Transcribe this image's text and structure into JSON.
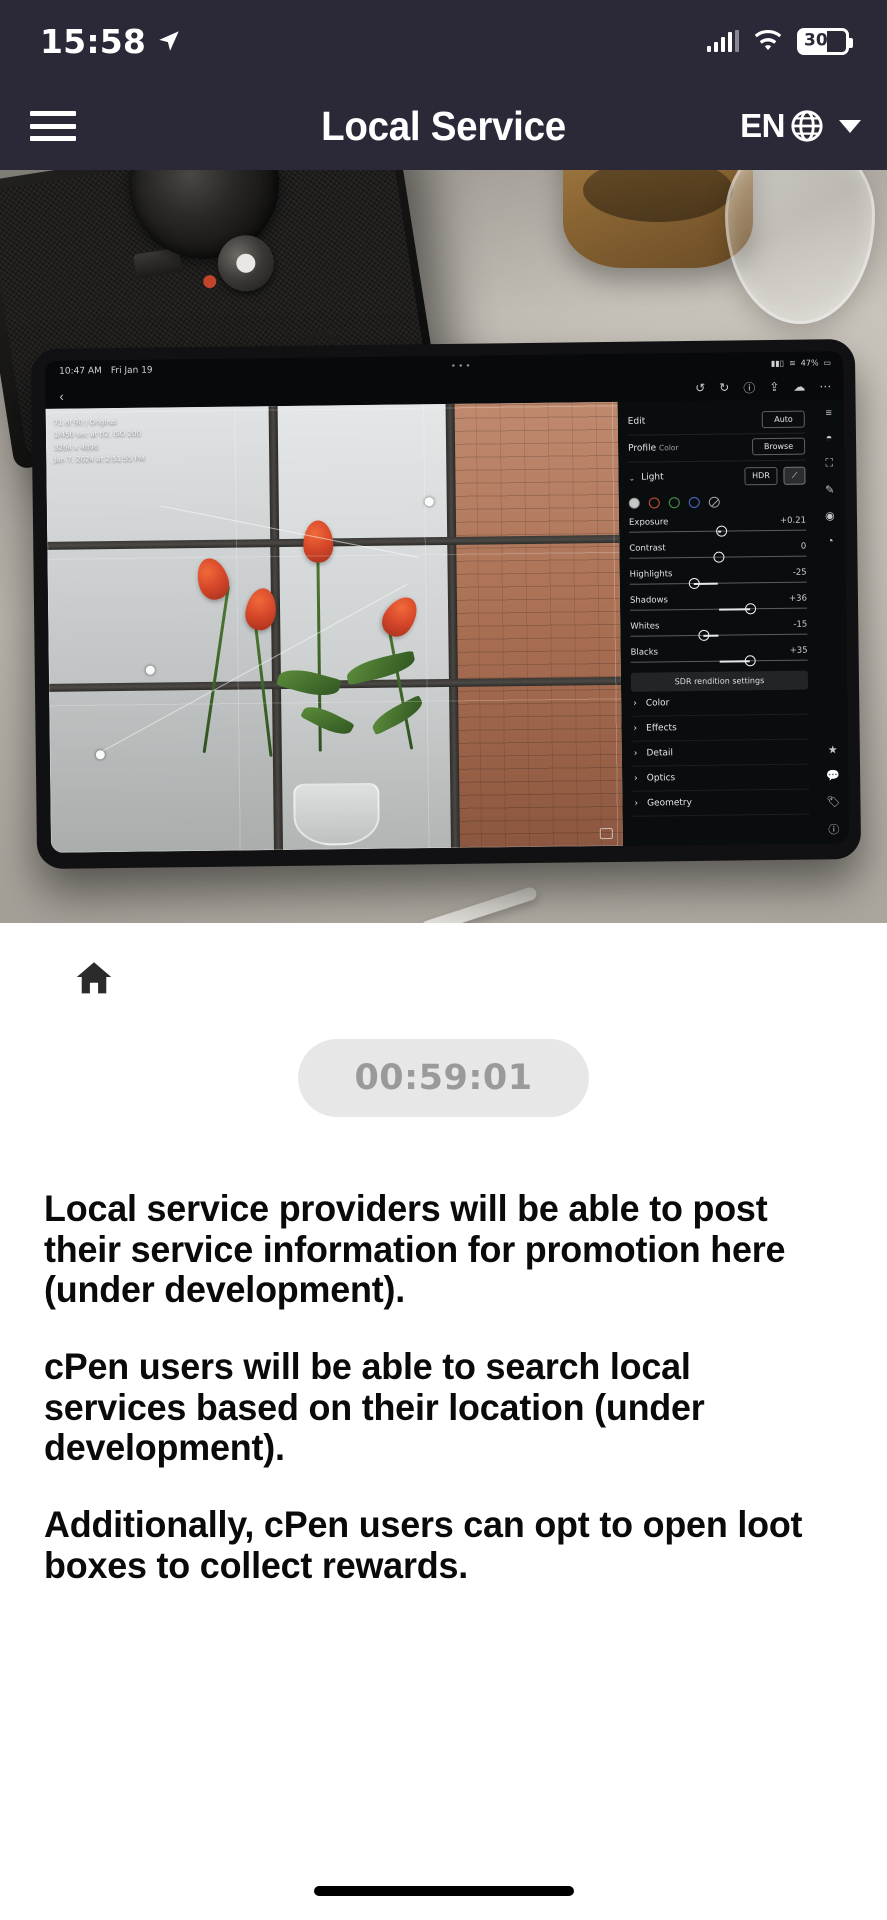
{
  "status_bar": {
    "time": "15:58",
    "location_icon": "location-arrow-icon",
    "signal_icon": "cellular-signal-icon",
    "wifi_icon": "wifi-icon",
    "battery_level": "30",
    "battery_icon": "battery-icon"
  },
  "header": {
    "menu_icon": "hamburger-menu-icon",
    "title": "Local Service",
    "language": "EN",
    "globe_icon": "globe-icon",
    "caret_icon": "chevron-down-icon"
  },
  "hero": {
    "alt": "Tablet with photo editing app on desk beside camera and coffee mug",
    "tablet": {
      "status": {
        "time": "10:47 AM",
        "date": "Fri Jan 19",
        "battery_percent": "47%"
      },
      "photo_meta": [
        "71 of 90 | Original",
        "1/450 sec at f/2, ISO 200",
        "3264 x 4896",
        "Jan 7, 2024 at 2:51:55 PM"
      ],
      "panel": {
        "edit_label": "Edit",
        "auto_button": "Auto",
        "profile_label": "Profile",
        "profile_value": "Color",
        "browse_button": "Browse",
        "light_label": "Light",
        "hdr_button": "HDR",
        "curve_icon": "tone-curve-icon",
        "sliders": [
          {
            "name": "Exposure",
            "value": "+0.21",
            "pos": 52,
            "fill_from": 50
          },
          {
            "name": "Contrast",
            "value": "0",
            "pos": 50,
            "fill_from": 50
          },
          {
            "name": "Highlights",
            "value": "-25",
            "pos": 36,
            "fill_from": 50
          },
          {
            "name": "Shadows",
            "value": "+36",
            "pos": 68,
            "fill_from": 50
          },
          {
            "name": "Whites",
            "value": "-15",
            "pos": 41,
            "fill_from": 50
          },
          {
            "name": "Blacks",
            "value": "+35",
            "pos": 67,
            "fill_from": 50
          }
        ],
        "sdr_button": "SDR rendition settings",
        "sections": [
          "Color",
          "Effects",
          "Detail",
          "Optics",
          "Geometry"
        ]
      }
    }
  },
  "main": {
    "home_icon": "home-icon",
    "timer": "00:59:01",
    "paragraphs": [
      "Local service providers will be able to post their service information for promotion here (under development).",
      "cPen users will be able to search local services based on their location (under development).",
      "Additionally, cPen users can opt to open loot boxes to collect rewards."
    ]
  },
  "colors": {
    "header_bg": "#2b2838",
    "timer_bg": "#e7e7e7",
    "timer_text": "#9a9a9a",
    "body_text": "#0a0a0a",
    "page_bg": "#ffffff"
  }
}
